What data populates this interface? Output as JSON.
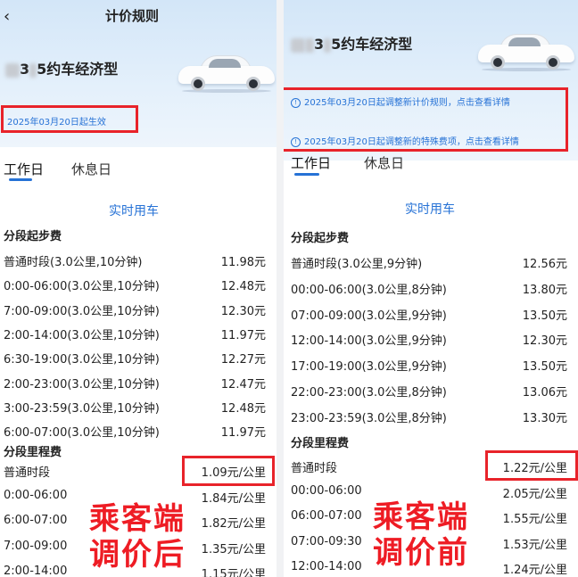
{
  "left": {
    "header_title": "计价规则",
    "car_title_mid": "3",
    "car_title_rest": "5约车经济型",
    "effective_date": "2025年03月20日起生效",
    "tab_workday": "工作日",
    "tab_holiday": "休息日",
    "mode": "实时用车",
    "start_fee_title": "分段起步费",
    "start_fee_rows": [
      {
        "label": "普通时段(3.0公里,10分钟)",
        "price": "11.98元"
      },
      {
        "label": "0:00-06:00(3.0公里,10分钟)",
        "price": "12.48元"
      },
      {
        "label": "7:00-09:00(3.0公里,10分钟)",
        "price": "12.30元"
      },
      {
        "label": "2:00-14:00(3.0公里,10分钟)",
        "price": "11.97元"
      },
      {
        "label": "6:30-19:00(3.0公里,10分钟)",
        "price": "12.27元"
      },
      {
        "label": "2:00-23:00(3.0公里,10分钟)",
        "price": "12.47元"
      },
      {
        "label": "3:00-23:59(3.0公里,10分钟)",
        "price": "12.48元"
      },
      {
        "label": "6:00-07:00(3.0公里,10分钟)",
        "price": "11.97元"
      }
    ],
    "mileage_title": "分段里程费",
    "mileage_rows": [
      {
        "label": "普通时段",
        "price": "1.09元/公里"
      },
      {
        "label": "0:00-06:00",
        "price": "1.84元/公里"
      },
      {
        "label": "6:00-07:00",
        "price": "1.82元/公里"
      },
      {
        "label": "7:00-09:00",
        "price": "1.35元/公里"
      },
      {
        "label": "2:00-14:00",
        "price": "1.15元/公里"
      }
    ],
    "overlay_line1": "乘客端",
    "overlay_line2": "调价后"
  },
  "right": {
    "car_title_mid": "3",
    "car_title_rest": "5约车经济型",
    "notice1": "2025年03月20日起调整新计价规则，点击查看详情",
    "notice2": "2025年03月20日起调整新的特殊费项，点击查看详情",
    "tab_workday": "工作日",
    "tab_holiday": "休息日",
    "mode": "实时用车",
    "start_fee_title": "分段起步费",
    "start_fee_rows": [
      {
        "label": "普通时段(3.0公里,9分钟)",
        "price": "12.56元"
      },
      {
        "label": "00:00-06:00(3.0公里,8分钟)",
        "price": "13.80元"
      },
      {
        "label": "07:00-09:00(3.0公里,9分钟)",
        "price": "13.50元"
      },
      {
        "label": "12:00-14:00(3.0公里,9分钟)",
        "price": "12.30元"
      },
      {
        "label": "17:00-19:00(3.0公里,9分钟)",
        "price": "13.50元"
      },
      {
        "label": "22:00-23:00(3.0公里,8分钟)",
        "price": "13.06元"
      },
      {
        "label": "23:00-23:59(3.0公里,8分钟)",
        "price": "13.30元"
      }
    ],
    "mileage_title": "分段里程费",
    "mileage_rows": [
      {
        "label": "普通时段",
        "price": "1.22元/公里"
      },
      {
        "label": "00:00-06:00",
        "price": "2.05元/公里"
      },
      {
        "label": "06:00-07:00",
        "price": "1.55元/公里"
      },
      {
        "label": "07:00-09:30",
        "price": "1.53元/公里"
      },
      {
        "label": "12:00-14:00",
        "price": "1.24元/公里"
      }
    ],
    "overlay_line1": "乘客端",
    "overlay_line2": "调价前"
  },
  "colors": {
    "accent_blue": "#2672d6",
    "highlight_red": "#e8232a",
    "overlay_red": "#ee1c24"
  }
}
